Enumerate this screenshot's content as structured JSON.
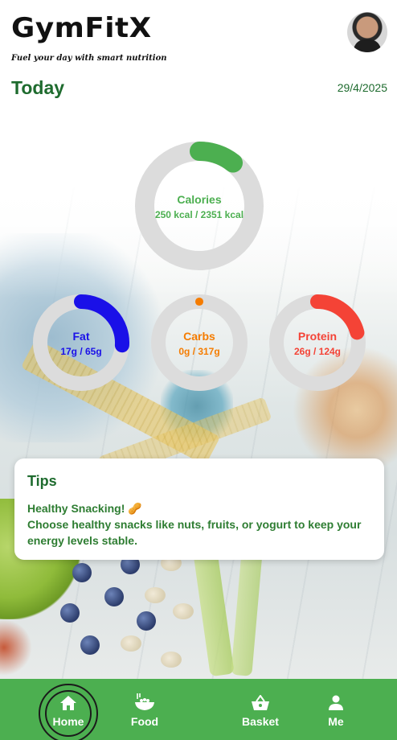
{
  "app": {
    "brand": "GymFitX",
    "tagline": "Fuel your day with smart nutrition"
  },
  "header": {
    "title": "Today",
    "date": "29/4/2025"
  },
  "rings": {
    "calories": {
      "label": "Calories",
      "value": "250 kcal / 2351 kcal",
      "fraction": 0.106,
      "color": "#4caf50"
    },
    "fat": {
      "label": "Fat",
      "value": "17g / 65g",
      "fraction": 0.26,
      "color": "#1a10e8"
    },
    "carbs": {
      "label": "Carbs",
      "value": "0g / 317g",
      "fraction": 0.0,
      "color": "#f57c00"
    },
    "protein": {
      "label": "Protein",
      "value": "26g / 124g",
      "fraction": 0.21,
      "color": "#f44336"
    },
    "track_color": "#dcdcdc"
  },
  "tips": {
    "title": "Tips",
    "heading": "Healthy Snacking! 🥜",
    "body": "Choose healthy snacks like nuts, fruits, or yogurt to keep your energy levels stable."
  },
  "nav": {
    "items": [
      {
        "label": "Home",
        "icon": "home-icon",
        "active": true
      },
      {
        "label": "Food",
        "icon": "food-bowl-icon",
        "active": false
      },
      {
        "label": "Basket",
        "icon": "basket-icon",
        "active": false
      },
      {
        "label": "Me",
        "icon": "person-icon",
        "active": false
      }
    ],
    "background": "#4caf50"
  }
}
